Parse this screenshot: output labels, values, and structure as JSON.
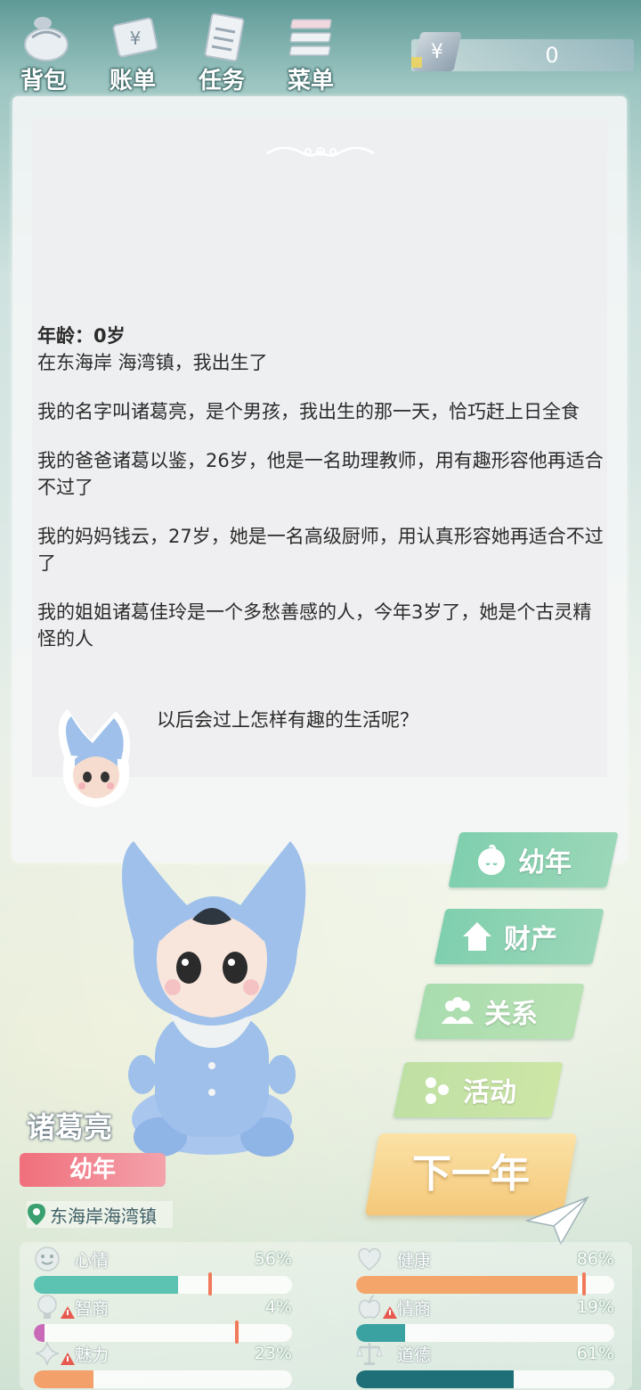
{
  "nav": [
    {
      "label": "背包",
      "icon": "bag-icon"
    },
    {
      "label": "账单",
      "icon": "bill-icon"
    },
    {
      "label": "任务",
      "icon": "task-icon"
    },
    {
      "label": "菜单",
      "icon": "menu-icon"
    }
  ],
  "money": {
    "symbol": "¥",
    "value": "0"
  },
  "story": {
    "age": "年龄：0岁",
    "paragraphs": [
      "在东海岸 海湾镇，我出生了",
      "我的名字叫诸葛亮，是个男孩，我出生的那一天，恰巧赶上日全食",
      "我的爸爸诸葛以鉴，26岁，他是一名助理教师，用有趣形容他再适合不过了",
      "我的妈妈钱云，27岁，她是一名高级厨师，用认真形容她再适合不过了",
      "我的姐姐诸葛佳玲是一个多愁善感的人，今年3岁了，她是个古灵精怪的人"
    ],
    "closing": "以后会过上怎样有趣的生活呢？"
  },
  "actions": {
    "stage": "幼年",
    "property": "财产",
    "relations": "关系",
    "activity": "活动",
    "next_year": "下一年"
  },
  "character": {
    "name": "诸葛亮",
    "stage": "幼年",
    "location": "东海岸海湾镇"
  },
  "stats": [
    {
      "label": "心情",
      "value": "56%",
      "level": 56,
      "color": "#5cc3b3"
    },
    {
      "label": "健康",
      "value": "86%",
      "level": 86,
      "color": "#f4a56a"
    },
    {
      "label": "智商",
      "value": "4%",
      "level": 4,
      "color": "#c86ab8"
    },
    {
      "label": "情商",
      "value": "19%",
      "level": 19,
      "color": "#3aa2a0"
    },
    {
      "label": "魅力",
      "value": "23%",
      "level": 23,
      "color": "#f3a06a"
    },
    {
      "label": "道德",
      "value": "61%",
      "level": 61,
      "color": "#1f6f79"
    }
  ]
}
